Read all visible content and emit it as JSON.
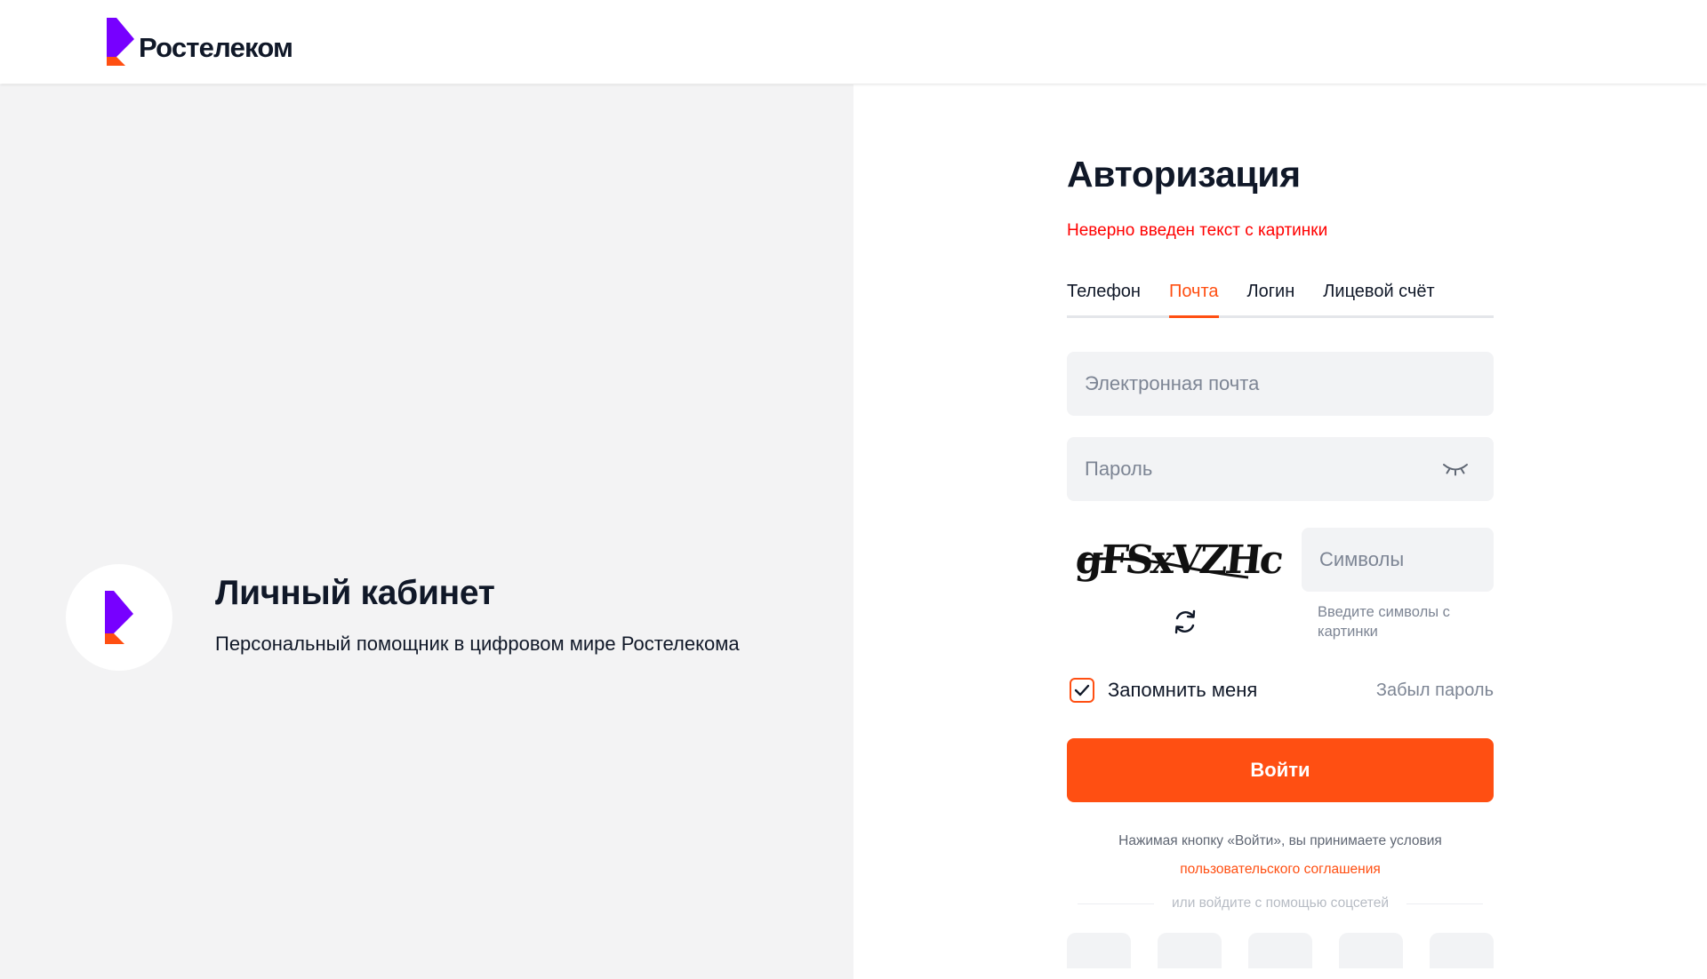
{
  "header": {
    "brand_name": "Ростелеком"
  },
  "promo": {
    "title": "Личный кабинет",
    "subtitle": "Персональный помощник в цифровом мире Ростелекома"
  },
  "form": {
    "title": "Авторизация",
    "error": "Неверно введен текст с картинки",
    "tabs": [
      {
        "label": "Телефон",
        "active": false
      },
      {
        "label": "Почта",
        "active": true
      },
      {
        "label": "Логин",
        "active": false
      },
      {
        "label": "Лицевой счёт",
        "active": false
      }
    ],
    "email": {
      "placeholder": "Электронная почта",
      "value": ""
    },
    "password": {
      "placeholder": "Пароль",
      "value": "",
      "toggle_icon": "eye-closed-icon"
    },
    "captcha": {
      "image_text": "gFSxVZHc",
      "refresh_icon": "refresh-icon",
      "input_placeholder": "Символы",
      "hint": "Введите символы с картинки"
    },
    "remember": {
      "label": "Запомнить меня",
      "checked": true
    },
    "forgot_label": "Забыл пароль",
    "submit_label": "Войти",
    "terms_text": "Нажимая кнопку «Войти», вы принимаете условия",
    "terms_link": "пользовательского соглашения",
    "social_divider": "или войдите с помощью соцсетей"
  },
  "colors": {
    "accent": "#ff4f12",
    "error": "#ff0000",
    "brand_purple": "#7700ff",
    "text": "#101828",
    "muted": "#7d8594",
    "field_bg": "#f2f3f5",
    "panel_bg": "#f3f3f4"
  }
}
